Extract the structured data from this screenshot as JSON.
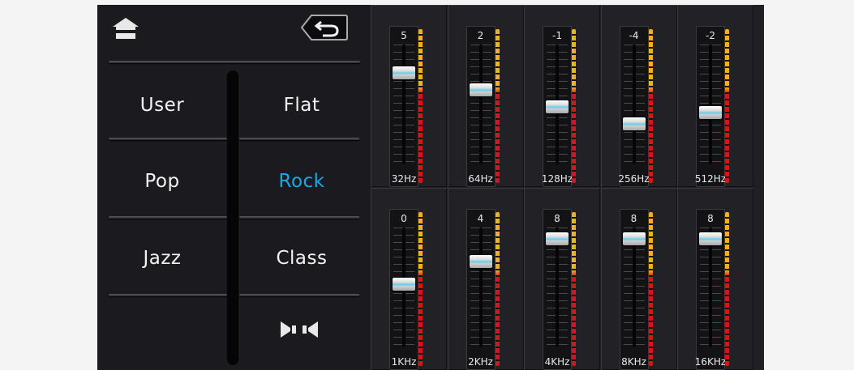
{
  "colors": {
    "active_preset": "#1aa7e6",
    "text": "#f2f2f2",
    "meter_top": "#f0b020",
    "meter_bottom": "#d01818"
  },
  "toolbar": {
    "home_icon": "home-icon",
    "back_icon": "back-arrow-icon"
  },
  "presets": {
    "user": "User",
    "flat": "Flat",
    "pop": "Pop",
    "rock": "Rock",
    "jazz": "Jazz",
    "class": "Class",
    "active": "Rock",
    "surround_icon": "surround-speaker-icon"
  },
  "eq": {
    "bands": [
      {
        "freq": "32Hz",
        "value": "5"
      },
      {
        "freq": "64Hz",
        "value": "2"
      },
      {
        "freq": "128Hz",
        "value": "-1"
      },
      {
        "freq": "256Hz",
        "value": "-4"
      },
      {
        "freq": "512Hz",
        "value": "-2"
      },
      {
        "freq": "1KHz",
        "value": "0"
      },
      {
        "freq": "2KHz",
        "value": "4"
      },
      {
        "freq": "4KHz",
        "value": "8"
      },
      {
        "freq": "8KHz",
        "value": "8"
      },
      {
        "freq": "16KHz",
        "value": "8"
      }
    ]
  }
}
